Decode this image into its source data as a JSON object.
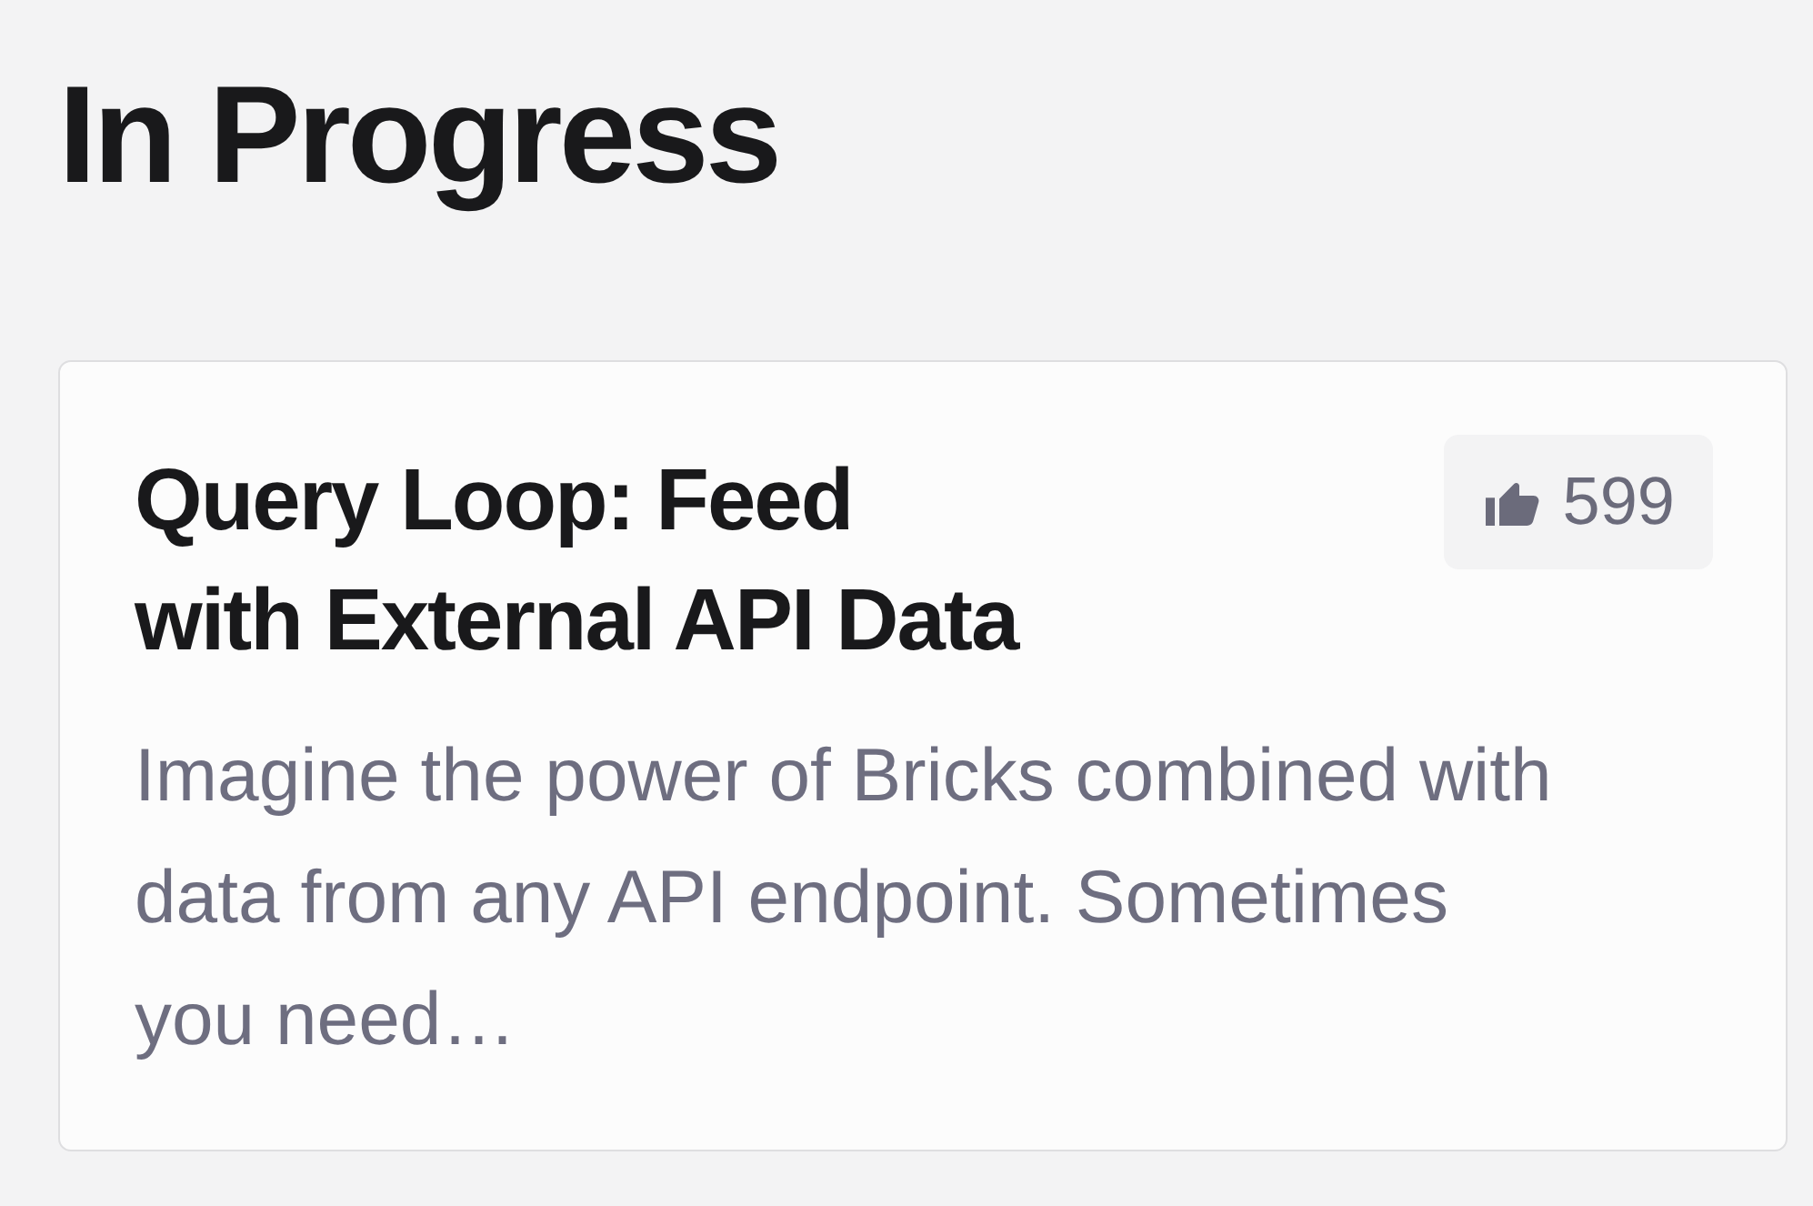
{
  "heading": "In Progress",
  "card": {
    "title": "Query Loop: Feed with External API Data",
    "votes": "599",
    "description": "Imagine the power of Bricks combined with data from any API endpoint. Sometimes you need…"
  }
}
